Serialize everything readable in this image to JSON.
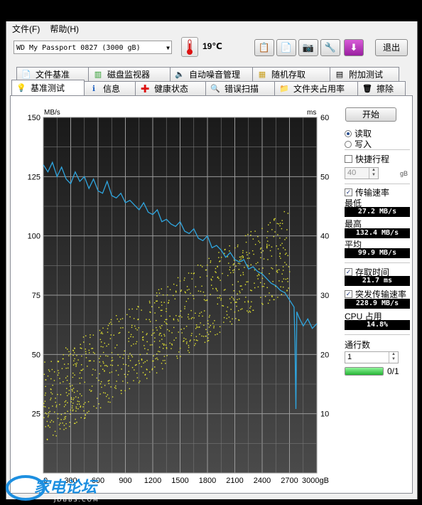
{
  "menu": {
    "file": "文件(F)",
    "help": "帮助(H)"
  },
  "toolbar": {
    "drive": "WD      My Passport 0827 (3000 gB)",
    "temperature": "19℃",
    "exit_label": "退出",
    "thermometer_icon": "thermometer-icon"
  },
  "tabs_top": [
    {
      "label": "文件基准",
      "icon": "file-benchmark-icon"
    },
    {
      "label": "磁盘监视器",
      "icon": "disk-monitor-icon"
    },
    {
      "label": "自动噪音管理",
      "icon": "speaker-icon"
    },
    {
      "label": "随机存取",
      "icon": "random-access-icon"
    },
    {
      "label": "附加测试",
      "icon": "extra-tests-icon"
    }
  ],
  "tabs_bottom": [
    {
      "label": "基准测试",
      "icon": "lightbulb-icon",
      "active": true
    },
    {
      "label": "信息",
      "icon": "info-icon"
    },
    {
      "label": "健康状态",
      "icon": "red-cross-icon"
    },
    {
      "label": "错误扫描",
      "icon": "magnifier-icon"
    },
    {
      "label": "文件夹占用率",
      "icon": "folder-icon"
    },
    {
      "label": "擦除",
      "icon": "trash-icon"
    }
  ],
  "side": {
    "start": "开始",
    "read": "读取",
    "write": "写入",
    "quick": "快捷行程",
    "quick_value": "40",
    "gb_unit": "gB",
    "transfer_rate": "传输速率",
    "min_label": "最低",
    "min_value": "27.2 MB/s",
    "max_label": "最高",
    "max_value": "132.4 MB/s",
    "avg_label": "平均",
    "avg_value": "99.9 MB/s",
    "access_time": "存取时间",
    "access_value": "21.7 ms",
    "burst": "突发传输速率",
    "burst_value": "228.9 MB/s",
    "cpu": "CPU 占用",
    "cpu_value": "14.8%",
    "passes": "通行数",
    "passes_value": "1",
    "progress_text": "0/1",
    "progress_fraction": 1.0
  },
  "chart_data": {
    "type": "line",
    "y_left_label": "MB/s",
    "y_right_label": "ms",
    "x_unit": "gB",
    "ylim_left": [
      0,
      150
    ],
    "ylim_right": [
      0,
      60
    ],
    "xlim": [
      0,
      3000
    ],
    "x_ticks": [
      0,
      300,
      600,
      900,
      1200,
      1500,
      1800,
      2100,
      2400,
      2700,
      3000
    ],
    "x_tick_labels": [
      "0",
      "300",
      "600",
      "900",
      "1200",
      "1500",
      "1800",
      "2100",
      "2400",
      "2700",
      "3000gB"
    ],
    "y_left_ticks": [
      25,
      50,
      75,
      100,
      125,
      150
    ],
    "y_right_ticks": [
      10,
      20,
      30,
      40,
      50,
      60
    ],
    "series": [
      {
        "name": "传输速率",
        "color": "#2fa6e0",
        "x": [
          0,
          50,
          100,
          150,
          200,
          250,
          300,
          350,
          400,
          450,
          500,
          550,
          600,
          650,
          700,
          750,
          800,
          850,
          900,
          950,
          1000,
          1050,
          1100,
          1150,
          1200,
          1250,
          1300,
          1350,
          1400,
          1450,
          1500,
          1550,
          1600,
          1650,
          1700,
          1750,
          1800,
          1850,
          1900,
          1950,
          2000,
          2050,
          2100,
          2150,
          2200,
          2250,
          2300,
          2350,
          2400,
          2450,
          2500,
          2550,
          2600,
          2650,
          2700,
          2750,
          2760,
          2770,
          2780,
          2800,
          2850,
          2900,
          2950,
          3000
        ],
        "y": [
          130,
          127,
          131,
          125,
          129,
          124,
          122,
          127,
          123,
          125,
          120,
          124,
          119,
          118,
          123,
          117,
          116,
          118,
          114,
          115,
          113,
          111,
          114,
          110,
          109,
          111,
          106,
          107,
          105,
          104,
          106,
          102,
          101,
          103,
          99,
          98,
          100,
          95,
          96,
          94,
          91,
          93,
          90,
          89,
          90,
          86,
          87,
          85,
          84,
          82,
          80,
          79,
          77,
          76,
          73,
          70,
          55,
          27,
          68,
          66,
          62,
          65,
          61,
          63
        ]
      },
      {
        "name": "存取时间",
        "type": "scatter",
        "color": "#e8e830",
        "axis": "right",
        "trend_start": [
          0,
          12
        ],
        "trend_end": [
          2700,
          38
        ],
        "spread": 7
      }
    ]
  }
}
